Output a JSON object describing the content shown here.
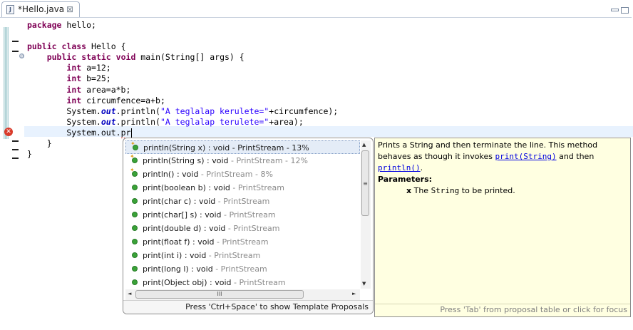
{
  "tab": {
    "icon_letter": "J",
    "title": "*Hello.java",
    "close": "⊠"
  },
  "editor": {
    "error_icon": "error-icon",
    "fold_symbol": "⊖",
    "lines": [
      {
        "parts": [
          {
            "t": "package",
            "c": "kw"
          },
          {
            "t": " hello;",
            "c": ""
          }
        ]
      },
      {
        "parts": []
      },
      {
        "parts": [
          {
            "t": "public",
            "c": "kw"
          },
          {
            "t": " ",
            "c": ""
          },
          {
            "t": "class",
            "c": "kw"
          },
          {
            "t": " Hello {",
            "c": ""
          }
        ]
      },
      {
        "parts": [
          {
            "t": "    ",
            "c": ""
          },
          {
            "t": "public",
            "c": "kw"
          },
          {
            "t": " ",
            "c": ""
          },
          {
            "t": "static",
            "c": "kw"
          },
          {
            "t": " ",
            "c": ""
          },
          {
            "t": "void",
            "c": "kw"
          },
          {
            "t": " main(String[] args) {",
            "c": ""
          }
        ]
      },
      {
        "parts": [
          {
            "t": "        ",
            "c": ""
          },
          {
            "t": "int",
            "c": "kw"
          },
          {
            "t": " a=12;",
            "c": ""
          }
        ]
      },
      {
        "parts": [
          {
            "t": "        ",
            "c": ""
          },
          {
            "t": "int",
            "c": "kw"
          },
          {
            "t": " b=25;",
            "c": ""
          }
        ]
      },
      {
        "parts": [
          {
            "t": "        ",
            "c": ""
          },
          {
            "t": "int",
            "c": "kw"
          },
          {
            "t": " area=a*b;",
            "c": ""
          }
        ]
      },
      {
        "parts": [
          {
            "t": "        ",
            "c": ""
          },
          {
            "t": "int",
            "c": "kw"
          },
          {
            "t": " circumfence=a+b;",
            "c": ""
          }
        ]
      },
      {
        "parts": [
          {
            "t": "        System.",
            "c": ""
          },
          {
            "t": "out",
            "c": "it"
          },
          {
            "t": ".println(",
            "c": ""
          },
          {
            "t": "\"A teglalap kerulete=\"",
            "c": "str"
          },
          {
            "t": "+circumfence);",
            "c": ""
          }
        ]
      },
      {
        "parts": [
          {
            "t": "        System.",
            "c": ""
          },
          {
            "t": "out",
            "c": "it"
          },
          {
            "t": ".println(",
            "c": ""
          },
          {
            "t": "\"A teglalap terulete=\"",
            "c": "str"
          },
          {
            "t": "+area);",
            "c": ""
          }
        ]
      },
      {
        "parts": [
          {
            "t": "        System.out.",
            "c": ""
          },
          {
            "t": "pr",
            "c": "typed"
          }
        ]
      },
      {
        "parts": [
          {
            "t": "    }",
            "c": ""
          }
        ]
      },
      {
        "parts": [
          {
            "t": "}",
            "c": ""
          }
        ]
      }
    ]
  },
  "proposals": {
    "items": [
      {
        "name": "println(String x) : void",
        "owner": " - PrintStream - 13%",
        "star": true,
        "selected": true,
        "owner_gray": false
      },
      {
        "name": "println(String s) : void",
        "owner": " - PrintStream - 12%",
        "star": true,
        "selected": false,
        "owner_gray": true
      },
      {
        "name": "println() : void",
        "owner": " - PrintStream - 8%",
        "star": true,
        "selected": false,
        "owner_gray": true
      },
      {
        "name": "print(boolean b) : void",
        "owner": " - PrintStream",
        "star": false,
        "selected": false,
        "owner_gray": true
      },
      {
        "name": "print(char c) : void",
        "owner": " - PrintStream",
        "star": false,
        "selected": false,
        "owner_gray": true
      },
      {
        "name": "print(char[] s) : void",
        "owner": " - PrintStream",
        "star": false,
        "selected": false,
        "owner_gray": true
      },
      {
        "name": "print(double d) : void",
        "owner": " - PrintStream",
        "star": false,
        "selected": false,
        "owner_gray": true
      },
      {
        "name": "print(float f) : void",
        "owner": " - PrintStream",
        "star": false,
        "selected": false,
        "owner_gray": true
      },
      {
        "name": "print(int i) : void",
        "owner": " - PrintStream",
        "star": false,
        "selected": false,
        "owner_gray": true
      },
      {
        "name": "print(long l) : void",
        "owner": " - PrintStream",
        "star": false,
        "selected": false,
        "owner_gray": true
      },
      {
        "name": "print(Object obj) : void",
        "owner": " - PrintStream",
        "star": false,
        "selected": false,
        "owner_gray": true
      }
    ],
    "footer": "Press 'Ctrl+Space' to show Template Proposals",
    "scroll_up": "▲",
    "scroll_down": "▼",
    "scroll_left": "◄",
    "scroll_right": "►",
    "grip_v": "≡",
    "grip_h": "III"
  },
  "doc": {
    "text1": "Prints a String and then terminate the line. This method behaves as though it invokes ",
    "link1": "print(String)",
    "text2": " and then ",
    "link2": "println()",
    "text3": ".",
    "params_heading": "Parameters:",
    "param_name": "x",
    "param_text1": " The ",
    "param_code": "String",
    "param_text2": " to be printed.",
    "footer": "Press 'Tab' from proposal table or click for focus"
  }
}
